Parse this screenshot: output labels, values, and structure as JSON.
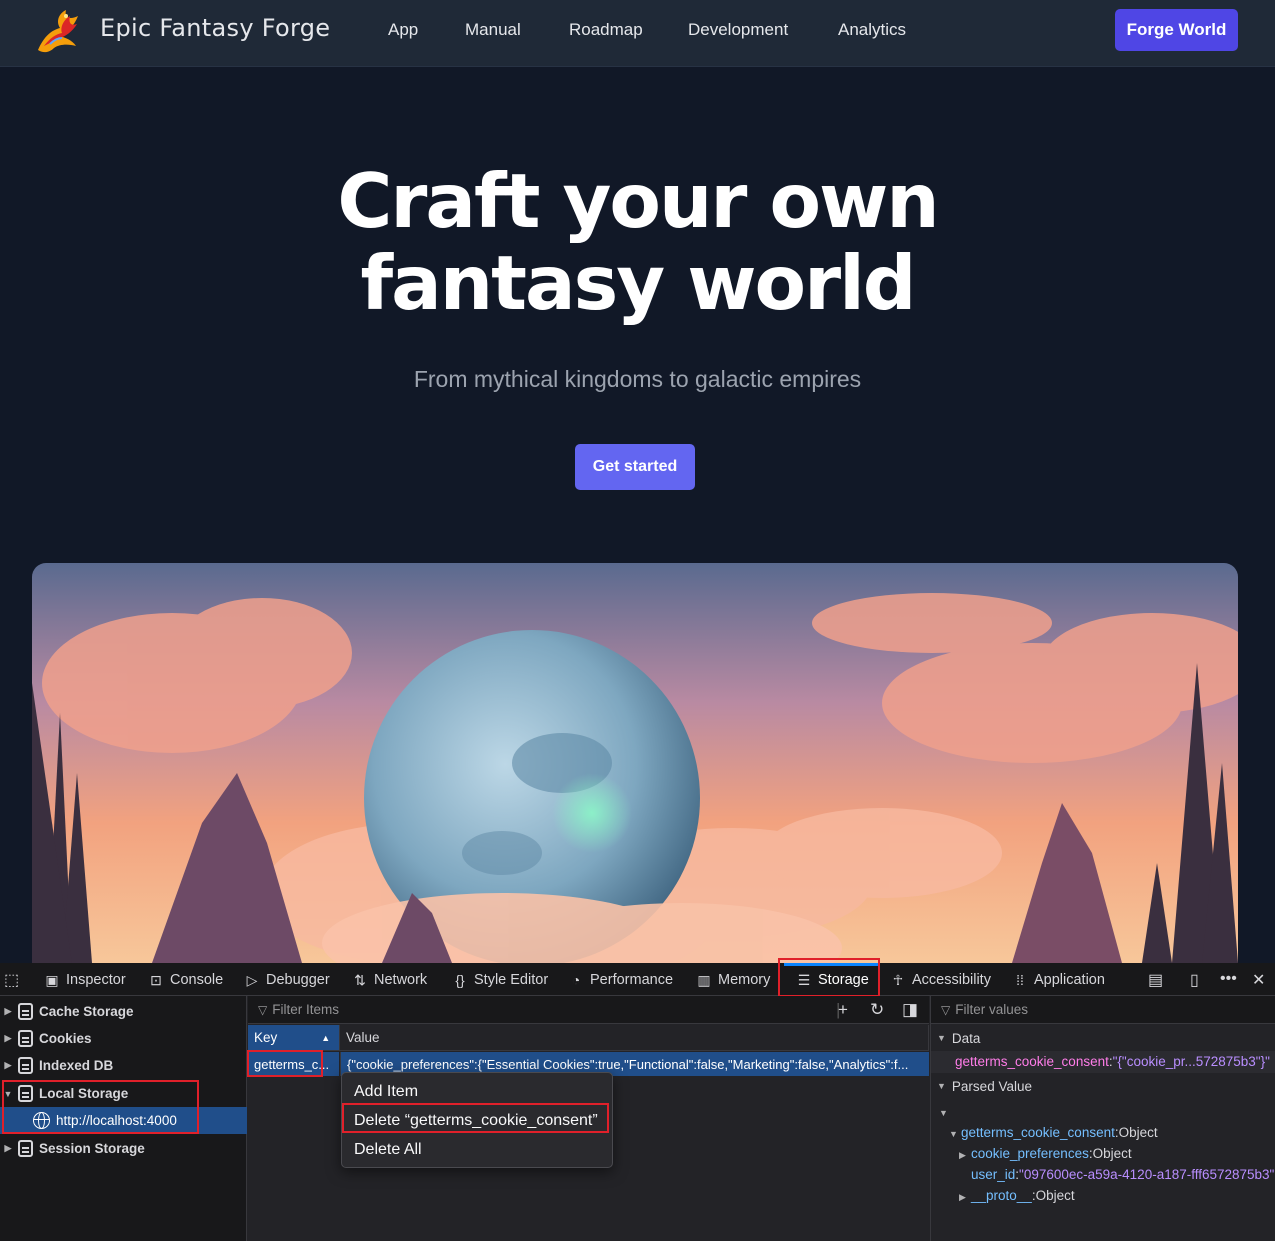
{
  "site": {
    "brand": "Epic Fantasy Forge",
    "nav": [
      "App",
      "Manual",
      "Roadmap",
      "Development",
      "Analytics"
    ],
    "cta": "Forge World",
    "colors": {
      "bg": "#111827",
      "nav_bg": "#1f2937",
      "accent": "#4f46e5",
      "accent_light": "#6366f1"
    }
  },
  "hero": {
    "title_line1": "Craft your own",
    "title_line2": "fantasy world",
    "subtitle": "From mythical kingdoms to galactic empires",
    "button": "Get started",
    "image": "fantasy-moon-sunset-landscape"
  },
  "devtools": {
    "tabs": [
      {
        "label": "Inspector",
        "icon": "inspector-icon"
      },
      {
        "label": "Console",
        "icon": "console-icon"
      },
      {
        "label": "Debugger",
        "icon": "debugger-icon"
      },
      {
        "label": "Network",
        "icon": "network-icon"
      },
      {
        "label": "Style Editor",
        "icon": "style-editor-icon"
      },
      {
        "label": "Performance",
        "icon": "performance-icon"
      },
      {
        "label": "Memory",
        "icon": "memory-icon"
      },
      {
        "label": "Storage",
        "icon": "storage-icon",
        "active": true
      },
      {
        "label": "Accessibility",
        "icon": "accessibility-icon"
      },
      {
        "label": "Application",
        "icon": "application-icon"
      }
    ],
    "tree": {
      "items": [
        "Cache Storage",
        "Cookies",
        "Indexed DB",
        "Local Storage",
        "Session Storage"
      ],
      "selected_child": "http://localhost:4000"
    },
    "table": {
      "filter_placeholder": "Filter Items",
      "columns": [
        "Key",
        "Value"
      ],
      "row": {
        "key": "getterms_c...",
        "value": "{\"cookie_preferences\":{\"Essential Cookies\":true,\"Functional\":false,\"Marketing\":false,\"Analytics\":f..."
      }
    },
    "context_menu": {
      "items": [
        "Add Item",
        "Delete “getterms_cookie_consent”",
        "Delete All"
      ]
    },
    "sidebar": {
      "filter_placeholder": "Filter values",
      "data_header": "Data",
      "data_key": "getterms_cookie_consent",
      "data_value": "\"{\"cookie_pr...572875b3\"}\"",
      "parsed_header": "Parsed Value",
      "parsed_root_key": "getterms_cookie_consent",
      "parsed_root_type": "Object",
      "pref_key": "cookie_preferences",
      "pref_type": "Object",
      "user_key": "user_id",
      "user_value": "\"097600ec-a59a-4120-a187-fff6572875b3\"",
      "proto_key": "__proto__",
      "proto_type": "Object"
    },
    "colors": {
      "selection": "#204e8a",
      "highlight_box": "#e0202a",
      "active_tab": "#0a84ff"
    }
  }
}
